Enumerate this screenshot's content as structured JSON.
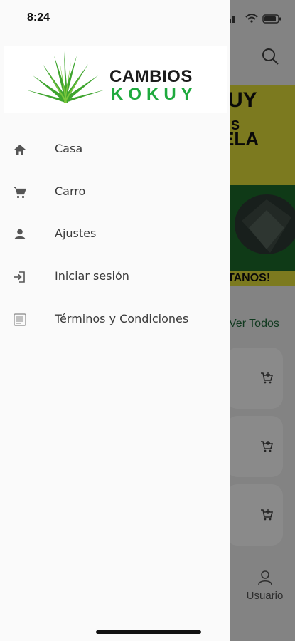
{
  "status_bar": {
    "time": "8:24"
  },
  "brand": {
    "line1": "CAMBIOS",
    "line2": "KOKUY"
  },
  "menu": [
    {
      "label": "Casa",
      "icon": "home-icon"
    },
    {
      "label": "Carro",
      "icon": "cart-icon"
    },
    {
      "label": "Ajustes",
      "icon": "person-icon"
    },
    {
      "label": "Iniciar sesión",
      "icon": "login-icon"
    },
    {
      "label": "Términos y Condiciones",
      "icon": "document-icon"
    }
  ],
  "background_app": {
    "banner": {
      "line1": "UY",
      "line2": "US",
      "line3": "ELA",
      "line4": "TANOS!"
    },
    "see_all": "Ver Todos",
    "bottom_nav_user": "Usuario"
  },
  "colors": {
    "brand_green": "#1faa3e",
    "banner_yellow": "#e6e23a",
    "banner_green": "#1d6c2c"
  }
}
